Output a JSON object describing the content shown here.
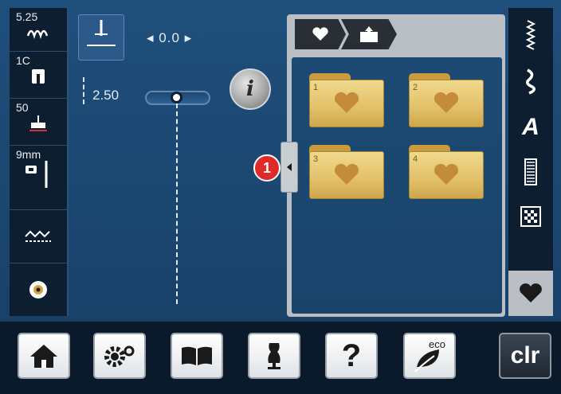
{
  "status": {
    "stitch_width": "5.25",
    "presser_foot": "1C",
    "needle_stop_value": "50",
    "needle_size": "9mm"
  },
  "controls": {
    "width_value": "0.0",
    "length_value": "2.50",
    "info_label": "i"
  },
  "folders": [
    {
      "number": "1"
    },
    {
      "number": "2"
    },
    {
      "number": "3"
    },
    {
      "number": "4"
    }
  ],
  "callout_number": "1",
  "categories": [
    {
      "icon": "practical-stitch-icon"
    },
    {
      "icon": "decorative-stitch-icon"
    },
    {
      "icon": "alphabet-icon",
      "label": "A"
    },
    {
      "icon": "buttonhole-icon"
    },
    {
      "icon": "quilt-stitch-icon"
    },
    {
      "icon": "heart-memory-icon"
    }
  ],
  "bottom": {
    "help_label": "?",
    "eco_label": "eco",
    "clear_label": "clr"
  },
  "colors": {
    "background": "#1d4a74",
    "folder": "#e2c068",
    "badge": "#e02a2a"
  }
}
